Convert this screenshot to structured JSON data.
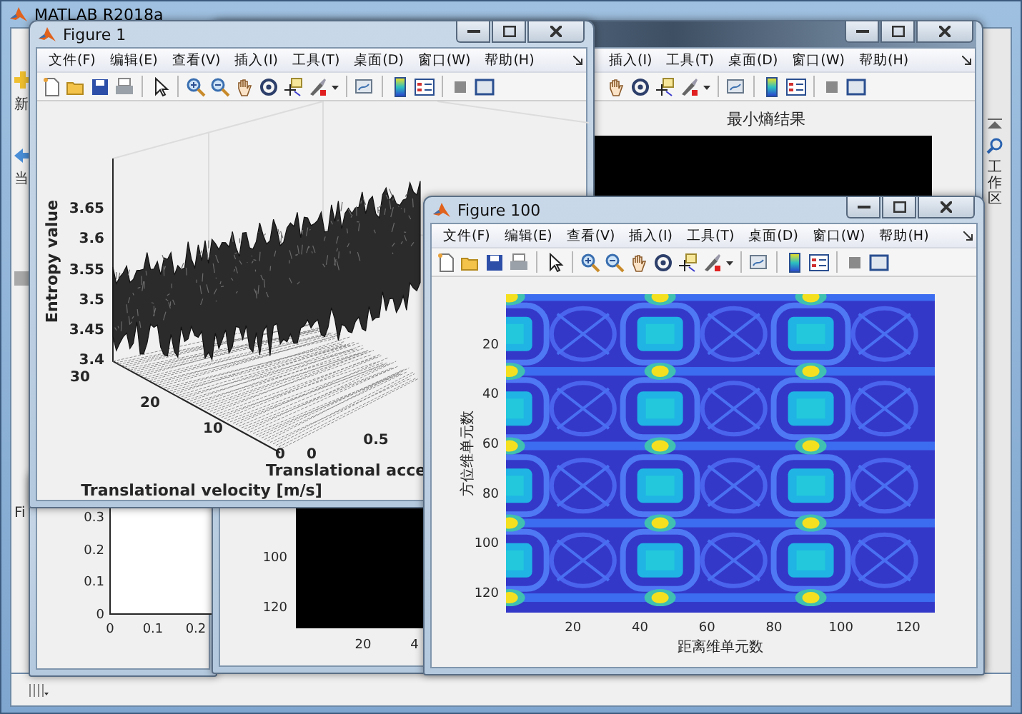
{
  "main_window": {
    "title": "MATLAB R2018a",
    "toolstrip_fragment": "新",
    "current_folder_fragment": "当",
    "panel_fragment": "Fi",
    "workspace_tab": "工作区"
  },
  "side_window": {
    "y_ticks": [
      "0.3",
      "0.2",
      "0.1",
      "0"
    ],
    "x_ticks": [
      "0",
      "0.1",
      "0.2"
    ]
  },
  "result_window": {
    "menu": [
      "插入(I)",
      "工具(T)",
      "桌面(D)",
      "窗口(W)",
      "帮助(H)"
    ],
    "plot_title": "最小熵结果",
    "y_ticks": [
      "100",
      "120"
    ],
    "x_ticks": [
      "20",
      "4"
    ]
  },
  "figure_1": {
    "title": "Figure 1",
    "menu": [
      "文件(F)",
      "编辑(E)",
      "查看(V)",
      "插入(I)",
      "工具(T)",
      "桌面(D)",
      "窗口(W)",
      "帮助(H)"
    ],
    "z_label": "Entropy value",
    "z_ticks": [
      "3.65",
      "3.6",
      "3.55",
      "3.5",
      "3.45",
      "3.4"
    ],
    "velocity_ticks": [
      "30",
      "20",
      "10",
      "0"
    ],
    "acceleration_ticks": [
      "0",
      "0.5"
    ],
    "velocity_label": "Translational velocity [m/s]",
    "acceleration_label": "Translational acce"
  },
  "figure_100": {
    "title": "Figure 100",
    "menu": [
      "文件(F)",
      "编辑(E)",
      "查看(V)",
      "插入(I)",
      "工具(T)",
      "桌面(D)",
      "窗口(W)",
      "帮助(H)"
    ],
    "y_label": "方位维单元数",
    "y_ticks": [
      "20",
      "40",
      "60",
      "80",
      "100",
      "120"
    ],
    "x_label": "距离维单元数",
    "x_ticks": [
      "20",
      "40",
      "60",
      "80",
      "100",
      "120"
    ]
  }
}
